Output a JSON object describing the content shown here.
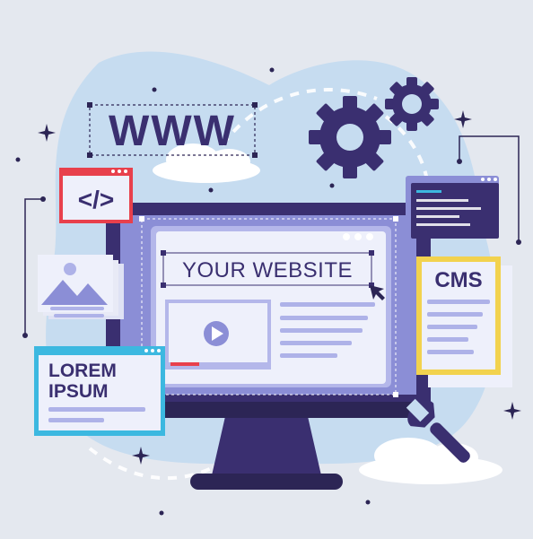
{
  "headline": "WWW",
  "website_text": "YOUR WEBSITE",
  "cms_label": "CMS",
  "lorem_line1": "LOREM",
  "lorem_line2": "IPSUM",
  "code_icon_text": "</>",
  "colors": {
    "background": "#e4e8ef",
    "blob": "#c6dcf0",
    "navy": "#3a2f70",
    "navy_dark": "#2c2555",
    "screen": "#8b8ed6",
    "panel": "#eef0fb",
    "panel_border": "#b4b7ea",
    "line": "#aeb2e8",
    "accent_red": "#e8404c",
    "accent_yellow": "#f2d24e",
    "accent_cyan": "#3cb8e0",
    "cloud": "#ffffff"
  },
  "icons": [
    "gear-icon",
    "gear-small-icon",
    "play-icon",
    "cursor-icon",
    "code-icon",
    "image-icon",
    "wrench-icon",
    "sparkle-icon"
  ]
}
